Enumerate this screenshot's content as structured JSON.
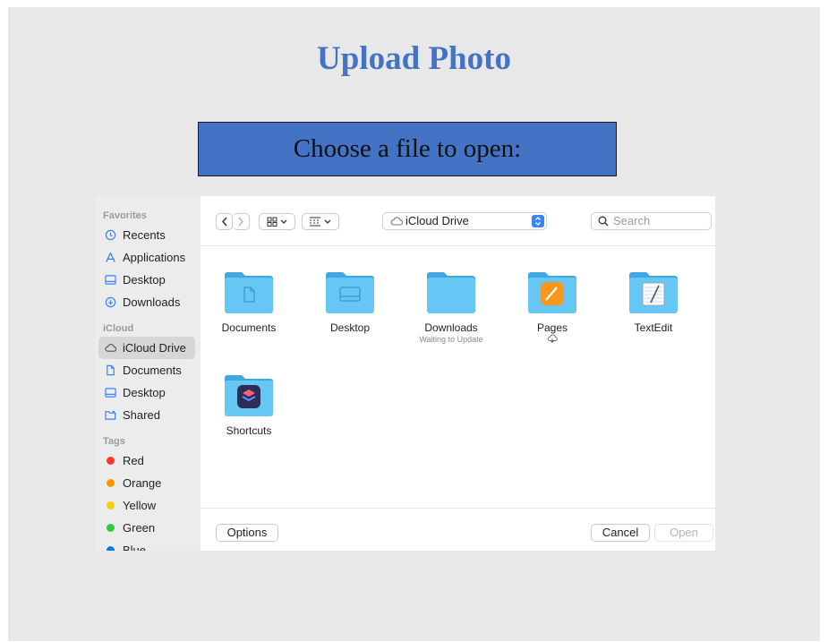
{
  "slide": {
    "title": "Upload Photo",
    "banner": "Choose a file to open:"
  },
  "sidebar": {
    "sections": [
      {
        "label": "Favorites",
        "items": [
          {
            "label": "Recents",
            "icon": "clock-icon"
          },
          {
            "label": "Applications",
            "icon": "applications-icon"
          },
          {
            "label": "Desktop",
            "icon": "desktop-icon"
          },
          {
            "label": "Downloads",
            "icon": "download-icon"
          }
        ]
      },
      {
        "label": "iCloud",
        "items": [
          {
            "label": "iCloud Drive",
            "icon": "cloud-icon",
            "selected": true
          },
          {
            "label": "Documents",
            "icon": "document-icon"
          },
          {
            "label": "Desktop",
            "icon": "desktop-icon"
          },
          {
            "label": "Shared",
            "icon": "shared-folder-icon"
          }
        ]
      },
      {
        "label": "Tags",
        "items": [
          {
            "label": "Red",
            "color": "#ff3b30"
          },
          {
            "label": "Orange",
            "color": "#ff9500"
          },
          {
            "label": "Yellow",
            "color": "#ffcc00"
          },
          {
            "label": "Green",
            "color": "#28cd41"
          },
          {
            "label": "Blue",
            "color": "#007aff"
          }
        ]
      }
    ]
  },
  "toolbar": {
    "back": "back-icon",
    "forward": "forward-icon",
    "view_icon": "grid-view-icon",
    "group_icon": "group-view-icon",
    "location": "iCloud Drive",
    "search_placeholder": "Search"
  },
  "files": [
    {
      "name": "Documents",
      "sub": "",
      "badge": "document"
    },
    {
      "name": "Desktop",
      "sub": "",
      "badge": "desktop"
    },
    {
      "name": "Downloads",
      "sub": "Waiting to Update",
      "badge": "none"
    },
    {
      "name": "Pages",
      "sub": "",
      "badge": "pages",
      "cloud": true
    },
    {
      "name": "TextEdit",
      "sub": "",
      "badge": "textedit"
    },
    {
      "name": "Shortcuts",
      "sub": "",
      "badge": "shortcuts"
    }
  ],
  "buttons": {
    "options": "Options",
    "cancel": "Cancel",
    "open": "Open"
  },
  "colors": {
    "accent": "#4472c4",
    "folder": "#5ec1f2",
    "selection": "#d6d6d6"
  }
}
